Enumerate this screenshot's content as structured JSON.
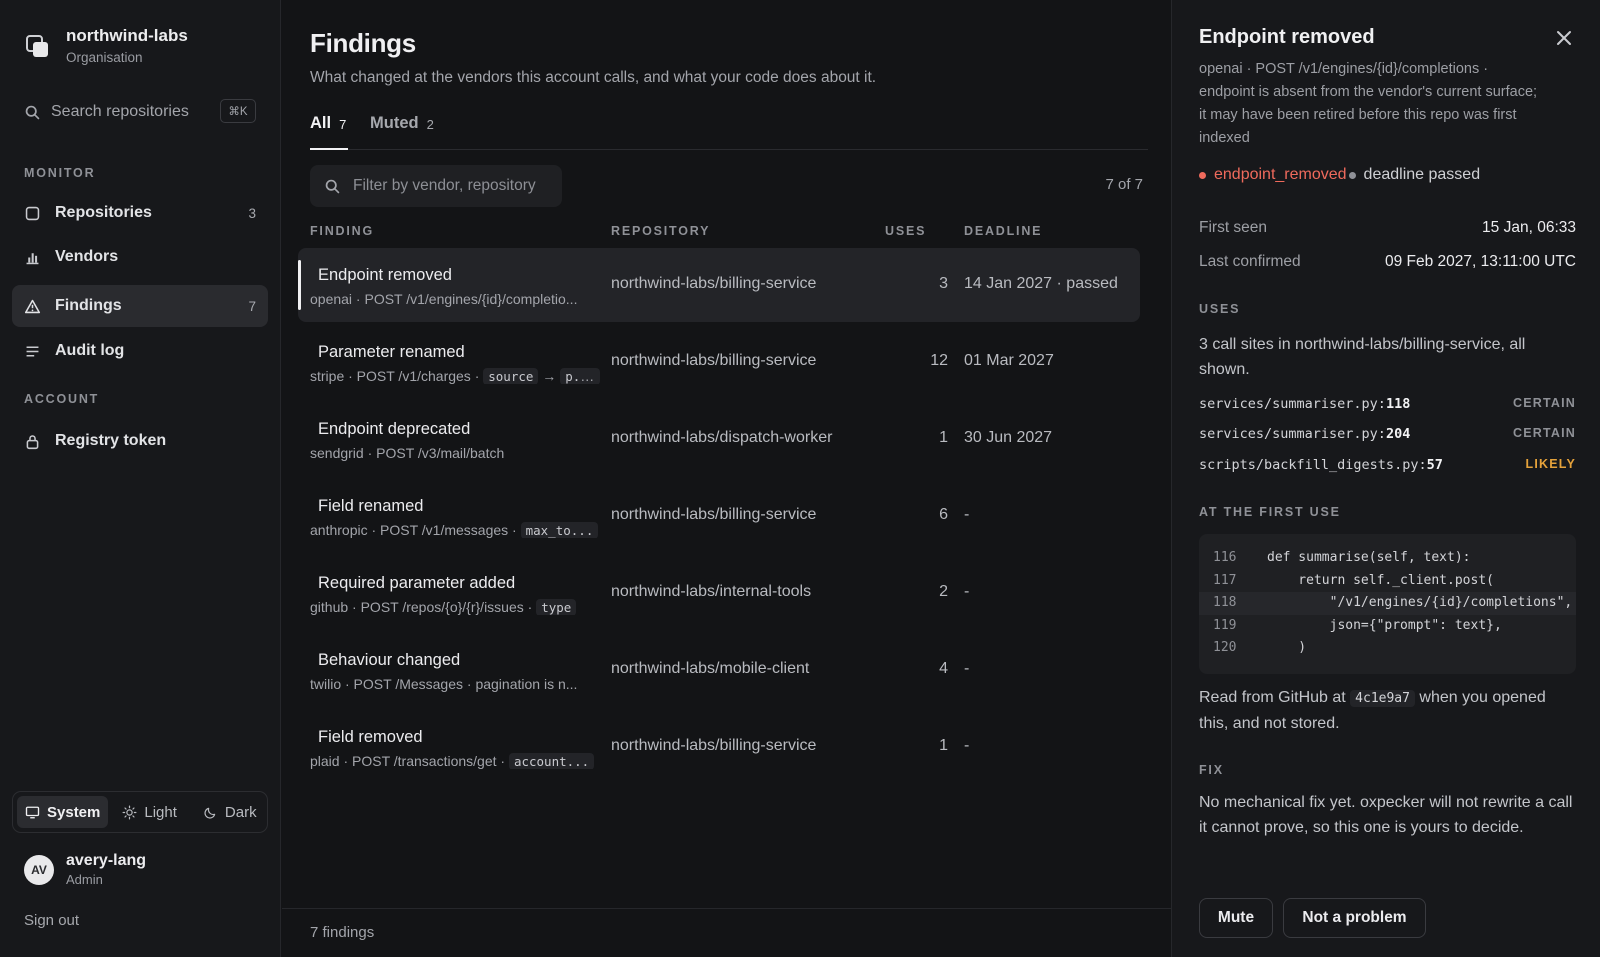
{
  "org": {
    "name": "northwind-labs",
    "subtitle": "Organisation"
  },
  "search": {
    "label": "Search repositories",
    "shortcut": "⌘K"
  },
  "sidebar": {
    "monitor_label": "MONITOR",
    "account_label": "ACCOUNT",
    "items": [
      {
        "label": "Repositories",
        "count": "3",
        "icon": "box-icon"
      },
      {
        "label": "Vendors",
        "count": "",
        "icon": "bar-chart-icon"
      },
      {
        "label": "Findings",
        "count": "7",
        "icon": "warning-icon",
        "active": true
      },
      {
        "label": "Audit log",
        "count": "",
        "icon": "list-icon"
      },
      {
        "label": "Registry token",
        "count": "",
        "icon": "lock-icon"
      }
    ]
  },
  "theme": {
    "options": [
      "System",
      "Light",
      "Dark"
    ],
    "selected": "System"
  },
  "user": {
    "initials": "AV",
    "name": "avery-lang",
    "role": "Admin",
    "sign_out": "Sign out"
  },
  "main": {
    "title": "Findings",
    "subtitle": "What changed at the vendors this account calls, and what your code does about it.",
    "tabs": [
      {
        "label": "All",
        "count": "7"
      },
      {
        "label": "Muted",
        "count": "2"
      }
    ],
    "filter_placeholder": "Filter by vendor, repository",
    "count_text": "7 of 7",
    "columns": {
      "finding": "FINDING",
      "repository": "REPOSITORY",
      "uses": "USES",
      "deadline": "DEADLINE"
    },
    "rows": [
      {
        "title": "Endpoint removed",
        "meta": "openai · POST /v1/engines/{id}/completio...",
        "repo": "northwind-labs/billing-service",
        "uses": "3",
        "deadline": "14 Jan 2027 · passed"
      },
      {
        "title": "Parameter renamed",
        "meta_prefix": "stripe · POST /v1/charges · ",
        "code1": "source",
        "arrow": " → ",
        "code2": "p...",
        "repo": "northwind-labs/billing-service",
        "uses": "12",
        "deadline": "01 Mar 2027"
      },
      {
        "title": "Endpoint deprecated",
        "meta": "sendgrid · POST /v3/mail/batch",
        "repo": "northwind-labs/dispatch-worker",
        "uses": "1",
        "deadline": "30 Jun 2027"
      },
      {
        "title": "Field renamed",
        "meta_prefix": "anthropic · POST /v1/messages · ",
        "code1": "max_to...",
        "repo": "northwind-labs/billing-service",
        "uses": "6",
        "deadline": "-"
      },
      {
        "title": "Required parameter added",
        "meta_prefix": "github · POST /repos/{o}/{r}/issues · ",
        "code1": "type",
        "repo": "northwind-labs/internal-tools",
        "uses": "2",
        "deadline": "-"
      },
      {
        "title": "Behaviour changed",
        "meta": "twilio · POST /Messages · pagination is n...",
        "repo": "northwind-labs/mobile-client",
        "uses": "4",
        "deadline": "-"
      },
      {
        "title": "Field removed",
        "meta_prefix": "plaid · POST /transactions/get · ",
        "code1": "account...",
        "repo": "northwind-labs/billing-service",
        "uses": "1",
        "deadline": "-"
      }
    ],
    "footer": "7 findings"
  },
  "detail": {
    "title": "Endpoint removed",
    "description": "openai · POST /v1/engines/{id}/completions · endpoint is absent from the vendor's current surface; it may have been retired before this repo was first indexed",
    "kind": "endpoint_removed",
    "deadline_status": "deadline passed",
    "first_seen_label": "First seen",
    "first_seen": "15 Jan, 06:33",
    "last_confirmed_label": "Last confirmed",
    "last_confirmed": "09 Feb 2027, 13:11:00 UTC",
    "uses_label": "USES",
    "uses_summary": "3 call sites in northwind-labs/billing-service, all shown.",
    "sites": [
      {
        "path": "services/summariser.py:",
        "line": "118",
        "confidence": "CERTAIN"
      },
      {
        "path": "services/summariser.py:",
        "line": "204",
        "confidence": "CERTAIN"
      },
      {
        "path": "scripts/backfill_digests.py:",
        "line": "57",
        "confidence": "LIKELY"
      }
    ],
    "first_use_label": "AT THE FIRST USE",
    "code": [
      {
        "ln": "116",
        "src": "def summarise(self, text):"
      },
      {
        "ln": "117",
        "src": "    return self._client.post("
      },
      {
        "ln": "118",
        "src": "        \"/v1/engines/{id}/completions\","
      },
      {
        "ln": "119",
        "src": "        json={\"prompt\": text},"
      },
      {
        "ln": "120",
        "src": "    )"
      }
    ],
    "source_note_prefix": "Read from GitHub at ",
    "source_sha": "4c1e9a7",
    "source_note_suffix": " when you opened this, and not stored.",
    "fix_label": "FIX",
    "fix_text": "No mechanical fix yet. oxpecker will not rewrite a call it cannot prove, so this one is yours to decide.",
    "mute_label": "Mute",
    "not_problem_label": "Not a problem"
  },
  "colors": {
    "accent_red": "#ef6a5c",
    "likely_amber": "#e5a23b"
  }
}
